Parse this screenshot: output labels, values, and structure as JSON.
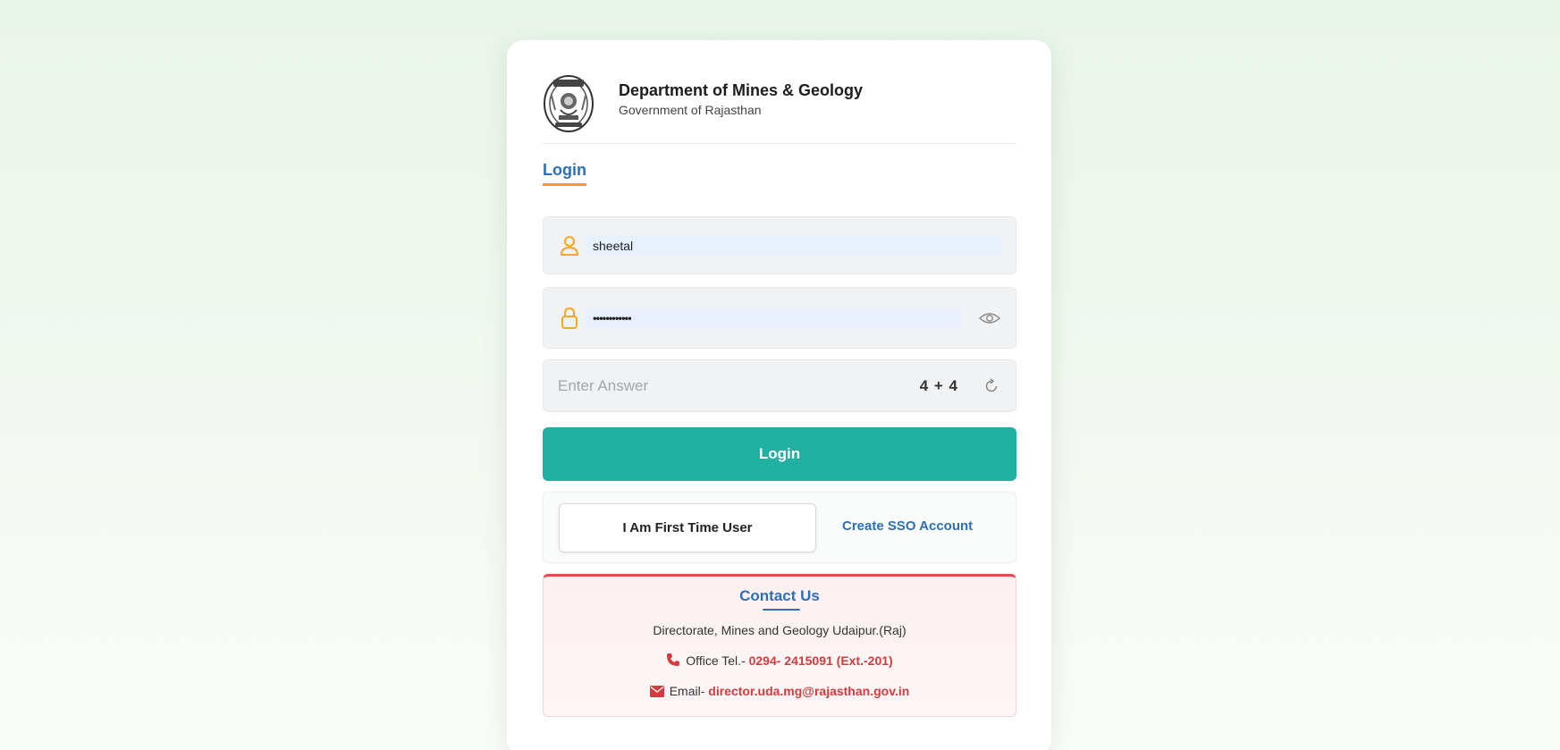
{
  "header": {
    "org_name": "Department of Mines & Geology",
    "org_sub": "Government of Rajasthan"
  },
  "tabs": {
    "login_label": "Login"
  },
  "form": {
    "username_value": "sheetal",
    "password_value": "••••••••••••",
    "captcha_placeholder": "Enter Answer",
    "captcha_question": "4 + 4",
    "login_button": "Login"
  },
  "actions": {
    "first_time_user": "I Am First Time User",
    "create_sso": "Create SSO Account"
  },
  "contact": {
    "title": "Contact Us",
    "address": "Directorate, Mines and Geology Udaipur.(Raj)",
    "tel_label": "Office Tel.-",
    "tel_value": "0294- 2415091 (Ext.-201)",
    "email_label": "Email-",
    "email_value": "director.uda.mg@rajasthan.gov.in"
  },
  "colors": {
    "accent_blue": "#2c6fbb",
    "login_teal": "#21b1a3",
    "tab_underline_orange": "#f59b2b",
    "contact_red": "#d63b3b"
  },
  "icons": {
    "emblem": "state-emblem-icon",
    "user": "user-icon",
    "lock": "lock-icon",
    "eye": "eye-icon",
    "refresh": "refresh-icon",
    "phone": "phone-icon",
    "mail": "mail-icon"
  }
}
